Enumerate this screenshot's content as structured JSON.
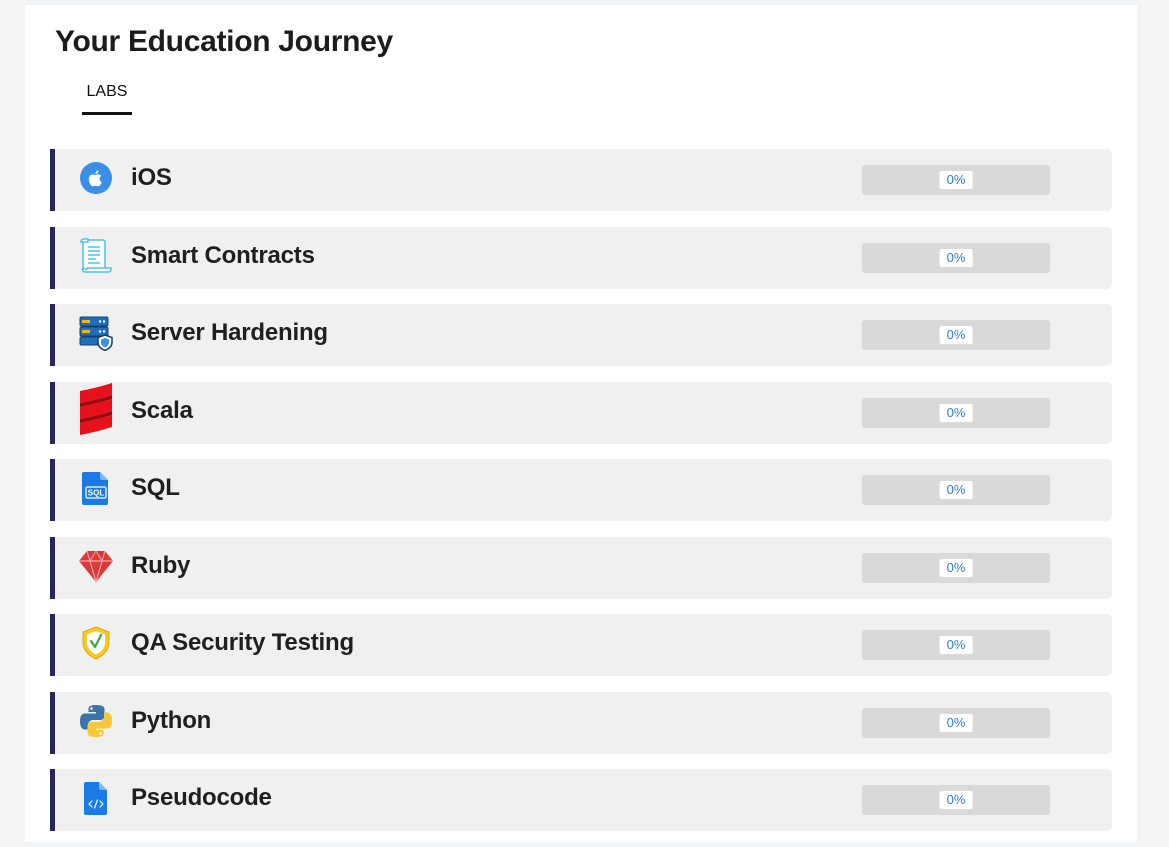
{
  "page": {
    "title": "Your Education Journey"
  },
  "tabs": [
    {
      "label": "LABS",
      "active": true
    }
  ],
  "labs": [
    {
      "name": "iOS",
      "icon": "apple-icon",
      "progress_label": "0%",
      "progress": 0
    },
    {
      "name": "Smart Contracts",
      "icon": "scroll-contract-icon",
      "progress_label": "0%",
      "progress": 0
    },
    {
      "name": "Server Hardening",
      "icon": "server-shield-icon",
      "progress_label": "0%",
      "progress": 0
    },
    {
      "name": "Scala",
      "icon": "scala-icon",
      "progress_label": "0%",
      "progress": 0
    },
    {
      "name": "SQL",
      "icon": "sql-file-icon",
      "progress_label": "0%",
      "progress": 0
    },
    {
      "name": "Ruby",
      "icon": "ruby-gem-icon",
      "progress_label": "0%",
      "progress": 0
    },
    {
      "name": "QA Security Testing",
      "icon": "shield-check-icon",
      "progress_label": "0%",
      "progress": 0
    },
    {
      "name": "Python",
      "icon": "python-icon",
      "progress_label": "0%",
      "progress": 0
    },
    {
      "name": "Pseudocode",
      "icon": "code-file-icon",
      "progress_label": "0%",
      "progress": 0
    }
  ],
  "colors": {
    "row_accent": "#262659",
    "row_background": "#f0f0f0",
    "progress_track": "#d9d9d9",
    "progress_text": "#2f80d8"
  }
}
